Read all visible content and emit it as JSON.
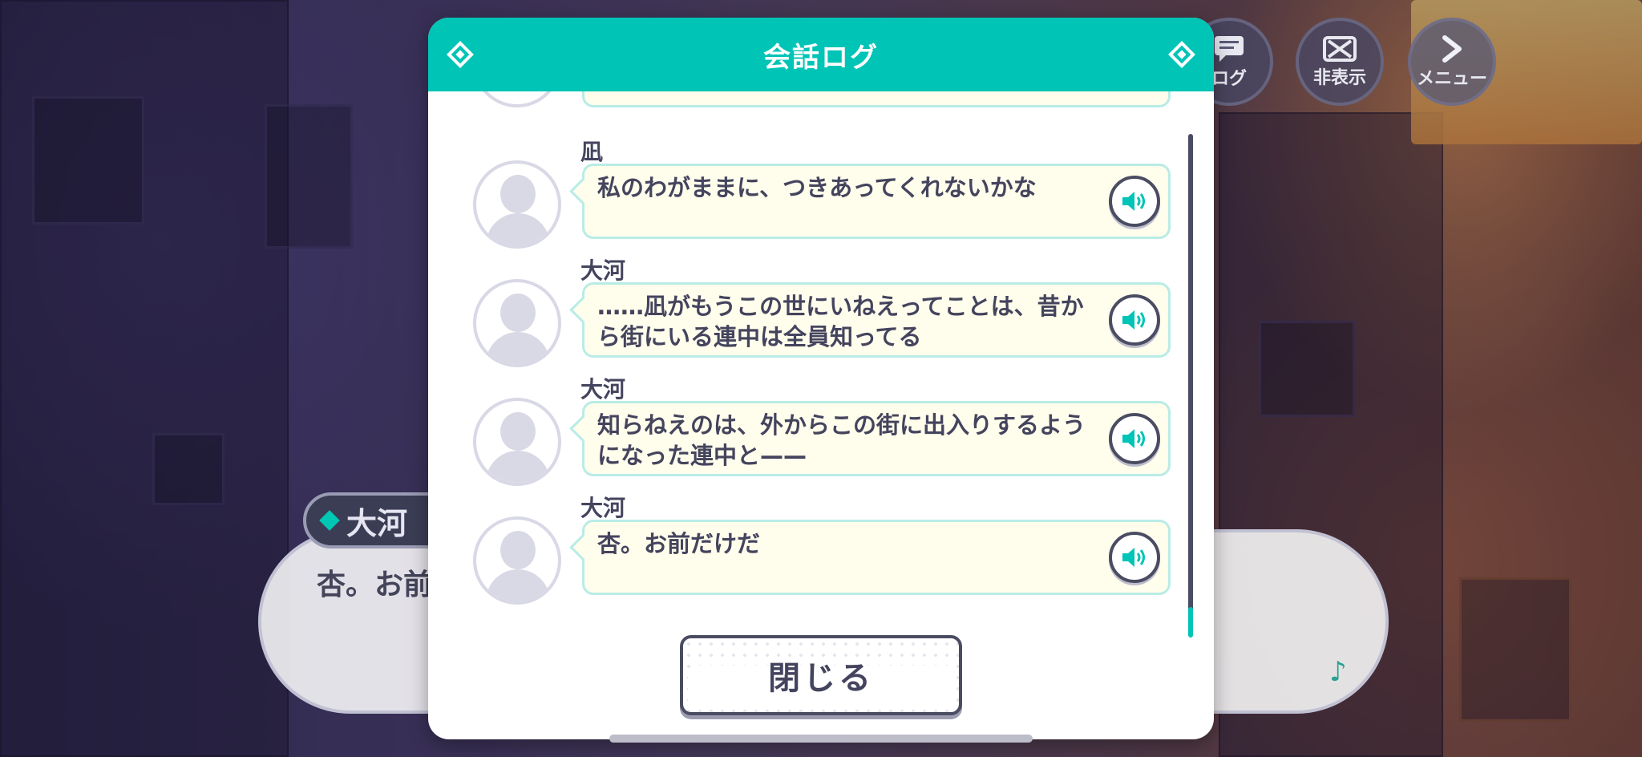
{
  "hud": {
    "log_label": "ログ",
    "hide_label": "非表示",
    "menu_label": "メニュー"
  },
  "background_dialog": {
    "speaker": "大河",
    "text": "杏。お前"
  },
  "modal": {
    "title": "会話ログ",
    "close_label": "閉じる",
    "entries": [
      {
        "speaker": "凪",
        "text": "私のわがままに、つきあってくれないかな"
      },
      {
        "speaker": "大河",
        "text": "……凪がもうこの世にいねえってことは、昔から街にいる連中は全員知ってる"
      },
      {
        "speaker": "大河",
        "text": "知らねえのは、外からこの街に出入りするようになった連中と——"
      },
      {
        "speaker": "大河",
        "text": "杏。お前だけだ"
      }
    ]
  },
  "colors": {
    "accent": "#00c4b6",
    "bubble_bg": "#fffdeb",
    "bubble_border": "#b9ece6",
    "text": "#44445e"
  }
}
